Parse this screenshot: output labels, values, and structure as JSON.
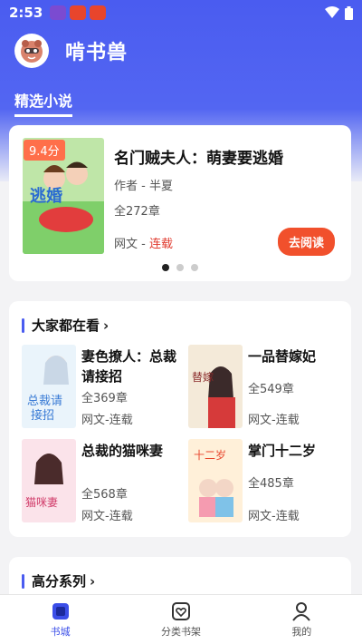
{
  "status_bar": {
    "time": "2:53",
    "app_icons": [
      "app-icon-1",
      "app-icon-2",
      "app-icon-3"
    ],
    "right_icons": [
      "wifi-icon",
      "battery-icon"
    ]
  },
  "app": {
    "title": "啃书兽"
  },
  "tabs": [
    {
      "label": "精选小说",
      "active": true
    }
  ],
  "featured": {
    "score": "9.4分",
    "title": "名门贼夫人：萌妻要逃婚",
    "author": "作者 - 半夏",
    "chapters": "全272章",
    "category_prefix": "网文 - ",
    "status": "连载",
    "read_button": "去阅读",
    "carousel_active_index": 0,
    "carousel_count": 3
  },
  "sections": [
    {
      "title": "大家都在看",
      "chevron": "›",
      "books": [
        {
          "title": "妻色撩人：总裁请接招",
          "chapters": "全369章",
          "category": "网文-连载"
        },
        {
          "title": "一品替嫁妃",
          "chapters": "全549章",
          "category": "网文-连载"
        },
        {
          "title": "总裁的猫咪妻",
          "chapters": "全568章",
          "category": "网文-连载"
        },
        {
          "title": "掌门十二岁",
          "chapters": "全485章",
          "category": "网文-连载"
        }
      ]
    },
    {
      "title": "高分系列",
      "chevron": "›"
    }
  ],
  "bottom_nav": [
    {
      "label": "书城",
      "icon": "bookstore-icon",
      "active": true
    },
    {
      "label": "分类书架",
      "icon": "shelf-icon",
      "active": false
    },
    {
      "label": "我的",
      "icon": "profile-icon",
      "active": false
    }
  ],
  "colors": {
    "primary": "#4a5cf0",
    "accent": "#f1502c",
    "badge": "#ff6f4a",
    "status_red": "#e0392d",
    "background": "#f3f3f5"
  }
}
